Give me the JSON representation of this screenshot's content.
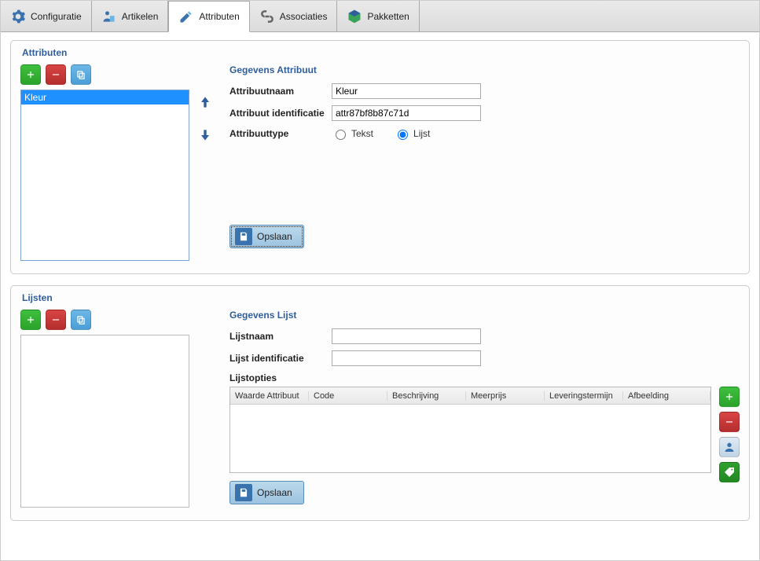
{
  "tabs": {
    "config": "Configuratie",
    "articles": "Artikelen",
    "attributes": "Attributen",
    "associations": "Associaties",
    "packages": "Pakketten"
  },
  "attributen": {
    "panel_title": "Attributen",
    "sub_title": "Gegevens Attribuut",
    "list": [
      "Kleur"
    ],
    "name_label": "Attribuutnaam",
    "name_value": "Kleur",
    "id_label": "Attribuut identificatie",
    "id_value": "attr87bf8b87c71d",
    "type_label": "Attribuuttype",
    "type_options": {
      "text": "Tekst",
      "list": "Lijst"
    },
    "type_selected": "list",
    "save_label": "Opslaan"
  },
  "lijsten": {
    "panel_title": "Lijsten",
    "sub_title": "Gegevens Lijst",
    "name_label": "Lijstnaam",
    "name_value": "",
    "id_label": "Lijst identificatie",
    "id_value": "",
    "options_label": "Lijstopties",
    "columns": [
      "Waarde Attribuut",
      "Code",
      "Beschrijving",
      "Meerprijs",
      "Leveringstermijn",
      "Afbeelding"
    ],
    "rows": [],
    "save_label": "Opslaan"
  }
}
